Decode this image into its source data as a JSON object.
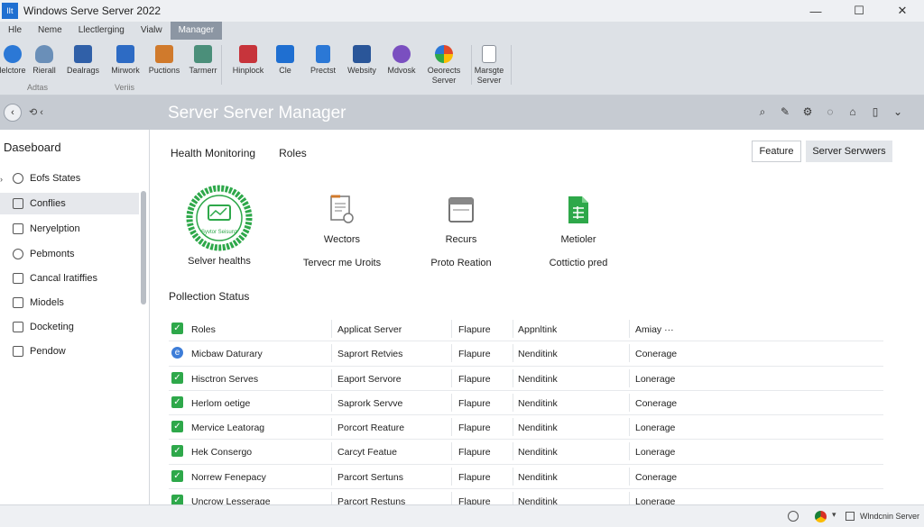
{
  "window": {
    "app_icon_text": "lIt",
    "title": "Windows Serve Server 2022",
    "minimize_glyph": "—",
    "maximize_glyph": "☐",
    "close_glyph": "✕"
  },
  "menu": [
    "Hle",
    "Neme",
    "Llectlerging",
    "Vialw",
    "Manager"
  ],
  "ribbon": {
    "tools": [
      {
        "label": "lelctore",
        "icon": "globe-icon",
        "color": "#2b78d6"
      },
      {
        "label": "Rierall",
        "icon": "cloud-icon",
        "color": "#6a8fb8"
      },
      {
        "label": "Dealrags",
        "icon": "grid-icon",
        "color": "#3060a8"
      },
      {
        "label": "Mirwork",
        "icon": "book-icon",
        "color": "#2d6bc4"
      },
      {
        "label": "Puctions",
        "icon": "puzzle-icon",
        "color": "#d07a2c"
      },
      {
        "label": "Tarmerr",
        "icon": "table-icon",
        "color": "#4b8f7a"
      },
      {
        "label": "Hinplock",
        "icon": "chart-icon",
        "color": "#c7343b"
      },
      {
        "label": "Cle",
        "icon": "outlook-icon",
        "color": "#1f6fd1"
      },
      {
        "label": "Prectst",
        "icon": "document-icon",
        "color": "#2b78d6"
      },
      {
        "label": "Websity",
        "icon": "word-icon",
        "color": "#2a5699"
      },
      {
        "label": "Mdvosk",
        "icon": "apps-icon",
        "color": "#7a4fc0"
      },
      {
        "label": "Oeorects Server",
        "icon": "colorwheel-icon",
        "color": "#e24a2b"
      },
      {
        "label": "Marsgte Server",
        "icon": "shield-icon",
        "color": "#8a9099"
      }
    ],
    "groups": [
      "Adtas",
      "Veriis"
    ]
  },
  "nav": {
    "back_glyph": "‹",
    "forward_glyph": "⟲ ‹",
    "title": "Server Server Manager",
    "icons": [
      "search-icon",
      "pen-icon",
      "settings-icon",
      "chat-icon",
      "tag-icon",
      "clipboard-icon",
      "chevron-down-icon"
    ]
  },
  "sidebar": {
    "dashboard": "Daseboard",
    "items": [
      {
        "label": "Eofs States"
      },
      {
        "label": "Conflies"
      },
      {
        "label": "Neryelption"
      },
      {
        "label": "Pebmonts"
      },
      {
        "label": "Cancal lratiffies"
      },
      {
        "label": "Miodels"
      },
      {
        "label": "Docketing"
      },
      {
        "label": "Pendow"
      }
    ]
  },
  "main": {
    "tabs": [
      "Health Monitoring",
      "Roles"
    ],
    "feature_button": "Feature",
    "servers_button": "Server Servwers",
    "tiles": [
      {
        "line1": "",
        "line2": "Selver healths",
        "ring_text": "Syvtor Seisunz"
      },
      {
        "line1": "Wectors",
        "line2": "Tervecr me Uroits"
      },
      {
        "line1": "Recurs",
        "line2": "Proto Reation"
      },
      {
        "line1": "Metioler",
        "line2": "Cottictio pred"
      }
    ],
    "section_title": "Pollection Status",
    "columns_extra": "Amiay ···",
    "rows": [
      {
        "status": "check",
        "name": "Roles",
        "c2": "Applicat Server",
        "c3": "Flapure",
        "c4": "Appnltink",
        "c5": "Amiay ···"
      },
      {
        "status": "globe",
        "name": "Micbaw Daturary",
        "c2": "Saprort Retvies",
        "c3": "Flapure",
        "c4": "Nenditink",
        "c5": "Conerage"
      },
      {
        "status": "check",
        "name": "Hisctron Serves",
        "c2": "Eaport Servore",
        "c3": "Flapure",
        "c4": "Nenditink",
        "c5": "Lonerage"
      },
      {
        "status": "check",
        "name": "Herlom oetige",
        "c2": "Saprork Servve",
        "c3": "Flapure",
        "c4": "Nenditink",
        "c5": "Conerage"
      },
      {
        "status": "check",
        "name": "Mervice Leatorag",
        "c2": "Porcort Reature",
        "c3": "Flapure",
        "c4": "Nenditink",
        "c5": "Lonerage"
      },
      {
        "status": "check",
        "name": "Hek Consergo",
        "c2": "Carcyt Featue",
        "c3": "Flapure",
        "c4": "Nenditink",
        "c5": "Lonerage"
      },
      {
        "status": "check",
        "name": "Norrew Fenepacy",
        "c2": "Parcort Sertuns",
        "c3": "Flapure",
        "c4": "Nenditink",
        "c5": "Conerage"
      },
      {
        "status": "check",
        "name": "Uncrow Lesserage",
        "c2": "Parcort Restuns",
        "c3": "Flapure",
        "c4": "Nenditink",
        "c5": "Lonerage"
      }
    ]
  },
  "statusbar": {
    "dropdown_glyph": "▾",
    "text": "Wlndcnin Server"
  },
  "colors": {
    "accent_green": "#2ea84a",
    "header_gray": "#c6cbd2",
    "ribbon_bg": "#dde1e6"
  }
}
